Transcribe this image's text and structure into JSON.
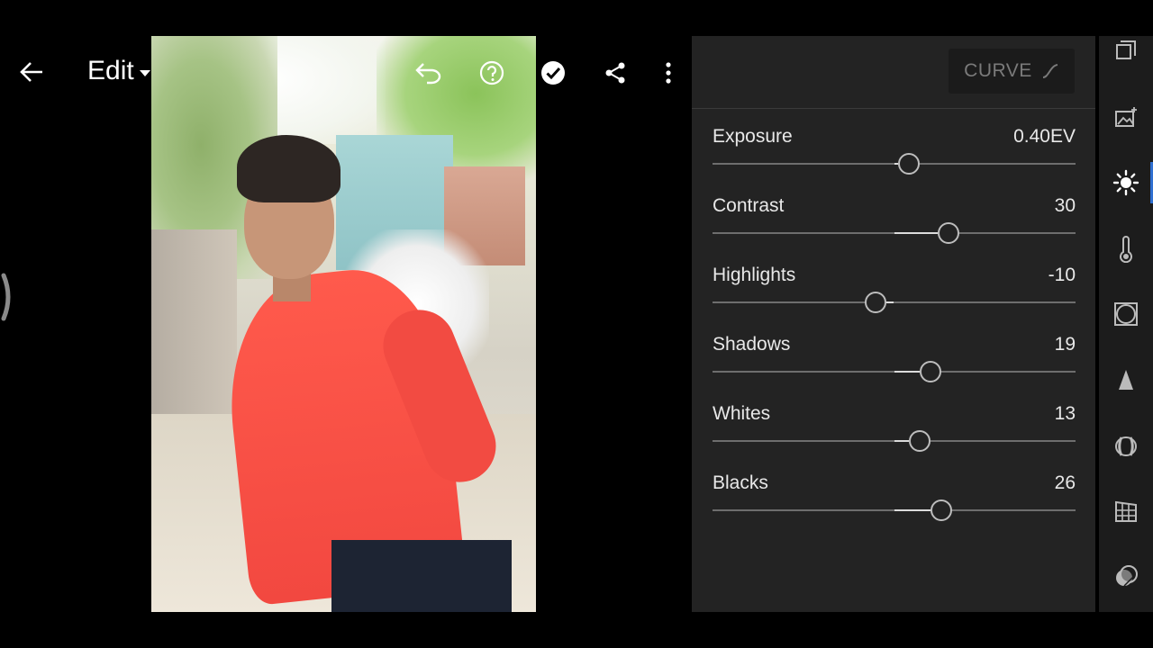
{
  "header": {
    "title": "Edit"
  },
  "curve": {
    "label": "CURVE"
  },
  "adjustments": [
    {
      "label": "Exposure",
      "value": "0.40EV",
      "level": 0.54
    },
    {
      "label": "Contrast",
      "value": "30",
      "level": 0.65
    },
    {
      "label": "Highlights",
      "value": "-10",
      "level": 0.45
    },
    {
      "label": "Shadows",
      "value": "19",
      "level": 0.6
    },
    {
      "label": "Whites",
      "value": "13",
      "level": 0.57
    },
    {
      "label": "Blacks",
      "value": "26",
      "level": 0.63
    }
  ],
  "rail_icons": [
    "presets-icon",
    "auto-enhance-icon",
    "light-icon",
    "color-temperature-icon",
    "effects-vignette-icon",
    "detail-icon",
    "optics-icon",
    "geometry-icon",
    "masking-icon"
  ],
  "active_rail": "light-icon",
  "colors": {
    "panel": "#232323",
    "accent": "#2f6fd0"
  }
}
